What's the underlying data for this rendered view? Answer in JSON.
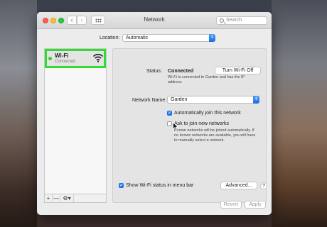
{
  "window": {
    "title": "Network",
    "nav": {
      "back": "‹",
      "forward": "›"
    },
    "search_placeholder": "Search"
  },
  "location": {
    "label": "Location:",
    "value": "Automatic"
  },
  "sidebar": {
    "items": [
      {
        "name": "Wi-Fi",
        "status": "Connected",
        "icon": "wifi-icon",
        "status_color": "#3bc93b"
      }
    ],
    "toolbar": {
      "add": "+",
      "remove": "—",
      "gear": "⚙▾"
    },
    "highlight_color": "#2fdc2f"
  },
  "panel": {
    "status_label": "Status:",
    "status_value": "Connected",
    "turn_off_button": "Turn Wi-Fi Off",
    "status_desc": "Wi-Fi is connected to Garden and has the IP address",
    "network_name_label": "Network Name:",
    "network_name_value": "Garden",
    "auto_join_label": "Automatically join this network",
    "auto_join_checked": true,
    "ask_join_label": "Ask to join new networks",
    "ask_join_checked": false,
    "ask_join_desc": "Known networks will be joined automatically. If no known networks are available, you will have to manually select a network.",
    "show_wifi_label": "Show Wi-Fi status in menu bar",
    "show_wifi_checked": true,
    "advanced_button": "Advanced...",
    "help_button": "?"
  },
  "footer": {
    "revert": "Revert",
    "apply": "Apply"
  },
  "colors": {
    "accent": "#1c6fe0"
  }
}
